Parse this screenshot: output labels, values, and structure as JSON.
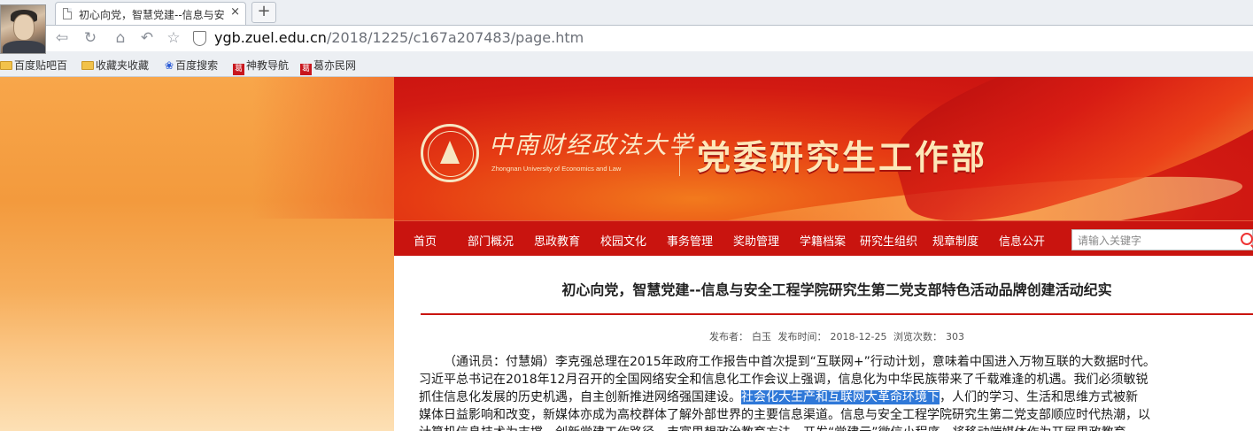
{
  "browser": {
    "tab_title": "初心向党，智慧党建--信息与安",
    "tab_close": "×",
    "new_tab": "+",
    "url_host": "ygb.zuel.edu.cn",
    "url_path": "/2018/1225/c167a207483/page.htm",
    "bookmarks": [
      {
        "label": "百度贴吧百",
        "icon": "folder-icon"
      },
      {
        "label": "收藏夹收藏",
        "icon": "folder-icon"
      },
      {
        "label": "百度搜索",
        "icon": "baidu-paw-icon"
      },
      {
        "label": "神教导航",
        "icon": "ge-icon"
      },
      {
        "label": "葛亦民网",
        "icon": "ge-icon"
      }
    ],
    "nav_icons": [
      "back-icon",
      "reload-icon",
      "home-icon",
      "undo-icon",
      "star-icon"
    ]
  },
  "banner": {
    "university_cn": "中南财经政法大学",
    "university_en": "Zhongnan University of Economics and Law",
    "department": "党委研究生工作部"
  },
  "nav": {
    "items": [
      "首页",
      "部门概况",
      "思政教育",
      "校园文化",
      "事务管理",
      "奖助管理",
      "学籍档案",
      "研究生组织",
      "规章制度",
      "信息公开"
    ],
    "search_placeholder": "请输入关键字"
  },
  "article": {
    "title": "初心向党，智慧党建--信息与安全工程学院研究生第二党支部特色活动品牌创建活动纪实",
    "publisher_label": "发布者：",
    "publisher": "白玉",
    "time_label": "发布时间：",
    "time": "2018-12-25",
    "views_label": "浏览次数：",
    "views": "303",
    "lines": [
      "（通讯员：付慧娟）李克强总理在2015年政府工作报告中首次提到“互联网+”行动计划，意味着中国进入万物互联的大数据时代。",
      "习近平总书记在2018年12月召开的全国网络安全和信息化工作会议上强调，信息化为中华民族带来了千载难逢的机遇。我们必须敏锐",
      "媒体日益影响和改变，新媒体亦成为高校群体了解外部世界的主要信息渠道。信息与安全工程学院研究生第二党支部顺应时代热潮，以",
      "计算机信息技术为支撑，创新党建工作路径，丰富思想政治教育方法，开发“党建云”微信小程序，将移动端媒体作为开展思政教育"
    ],
    "line3_before": "抓住信息化发展的历史机遇，自主创新推进网络强国建设。",
    "line3_highlight": "社会化大生产和互联网大革命环境下",
    "line3_after": "，人们的学习、生活和思维方式被新"
  }
}
